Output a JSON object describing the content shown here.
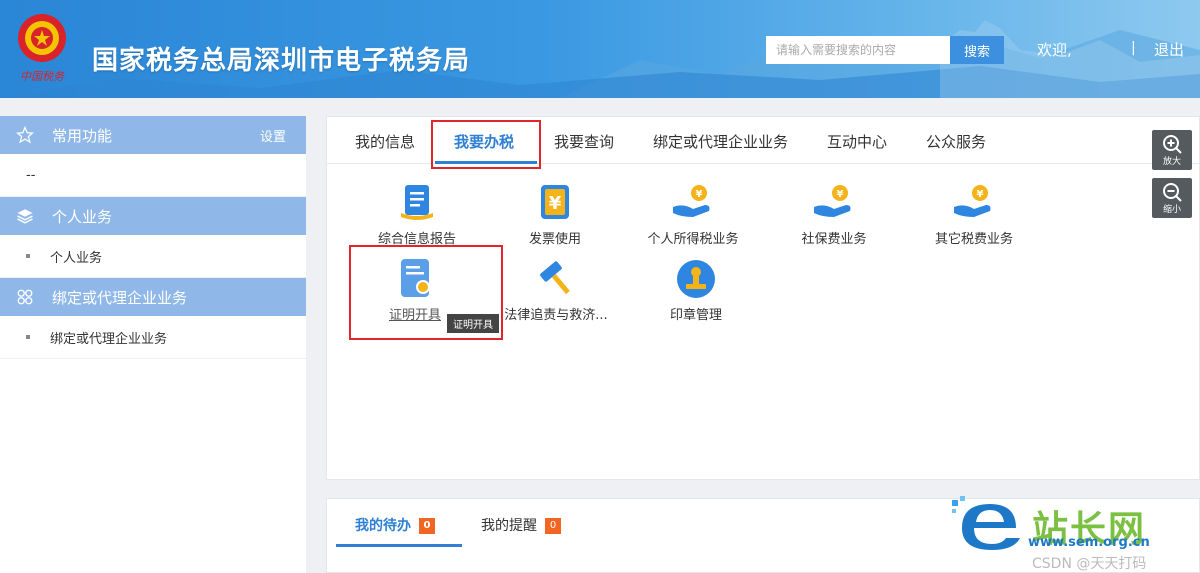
{
  "header": {
    "title": "国家税务总局深圳市电子税务局",
    "emblem_text": "中国税务",
    "search_placeholder": "请输入需要搜索的内容",
    "search_button": "搜索",
    "welcome": "欢迎,",
    "separator": "|",
    "logout": "退出"
  },
  "sidebar": {
    "sections": [
      {
        "label": "常用功能",
        "icon": "star-icon",
        "action": "设置",
        "items": [
          "--"
        ]
      },
      {
        "label": "个人业务",
        "icon": "layers-icon",
        "items": [
          "个人业务"
        ]
      },
      {
        "label": "绑定或代理企业业务",
        "icon": "grid-icon",
        "items": [
          "绑定或代理企业业务"
        ]
      }
    ]
  },
  "main": {
    "tabs": [
      "我的信息",
      "我要办税",
      "我要查询",
      "绑定或代理企业业务",
      "互动中心",
      "公众服务"
    ],
    "active_tab": "我要办税",
    "apps": [
      {
        "label": "综合信息报告",
        "icon": "report-icon"
      },
      {
        "label": "发票使用",
        "icon": "invoice-icon"
      },
      {
        "label": "个人所得税业务",
        "icon": "hand-coin-icon"
      },
      {
        "label": "社保费业务",
        "icon": "hand-coin-icon"
      },
      {
        "label": "其它税费业务",
        "icon": "hand-coin-icon"
      },
      {
        "label": "证明开具",
        "icon": "certificate-icon"
      },
      {
        "label": "法律追责与救济...",
        "icon": "gavel-icon"
      },
      {
        "label": "印章管理",
        "icon": "stamp-icon"
      }
    ],
    "tooltip": "证明开具"
  },
  "zoom": {
    "in": "放大",
    "out": "缩小"
  },
  "bottom": {
    "tabs": [
      {
        "label": "我的待办",
        "count": "0"
      },
      {
        "label": "我的提醒",
        "count": "0"
      }
    ]
  },
  "watermark": {
    "text": "站长网",
    "url": "www.sem.org.cn",
    "csdn": "CSDN @天天打码"
  },
  "colors": {
    "accent": "#2f7fd4",
    "sidebar_header": "#8fb8e8",
    "highlight": "#e0252b",
    "badge": "#f26522"
  }
}
